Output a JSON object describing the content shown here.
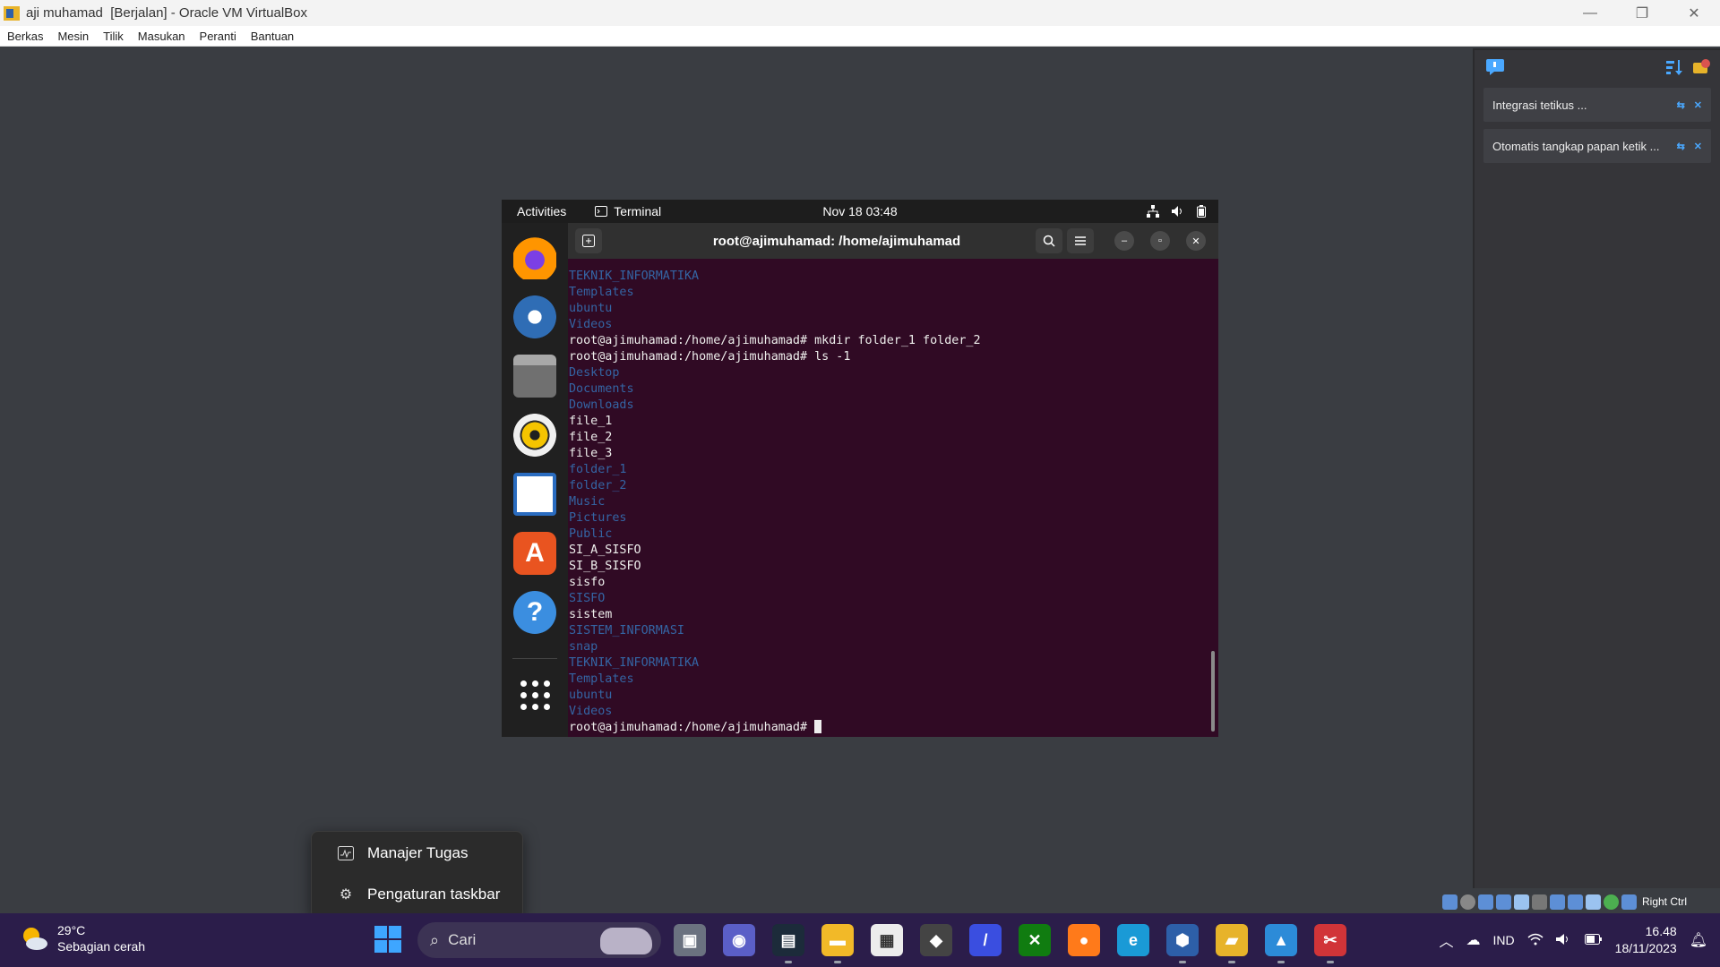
{
  "vbox": {
    "title": "aji muhamad  [Berjalan] - Oracle VM VirtualBox",
    "menu": [
      "Berkas",
      "Mesin",
      "Tilik",
      "Masukan",
      "Peranti",
      "Bantuan"
    ],
    "window_controls": {
      "minimize": "—",
      "restore": "❐",
      "close": "✕"
    }
  },
  "notifications": [
    {
      "text": "Integrasi tetikus ..."
    },
    {
      "text": "Otomatis tangkap papan ketik ..."
    }
  ],
  "host_key_label": "Right Ctrl",
  "gnome": {
    "activities": "Activities",
    "app_name": "Terminal",
    "clock": "Nov 18  03:48"
  },
  "dock": [
    {
      "name": "firefox",
      "color": "#e66000"
    },
    {
      "name": "thunderbird",
      "color": "#2f6db5"
    },
    {
      "name": "files",
      "color": "#8a8a8a"
    },
    {
      "name": "rhythmbox",
      "color": "#f5c400"
    },
    {
      "name": "libreoffice-writer",
      "color": "#2a6cc0"
    },
    {
      "name": "app-center",
      "color": "#e95420"
    },
    {
      "name": "help",
      "color": "#3b8ee0"
    }
  ],
  "terminal": {
    "title": "root@ajimuhamad: /home/ajimuhamad",
    "lines": [
      {
        "text": "TEKNIK_INFORMATIKA",
        "kind": "dir"
      },
      {
        "text": "Templates",
        "kind": "dir"
      },
      {
        "text": "ubuntu",
        "kind": "dir"
      },
      {
        "text": "Videos",
        "kind": "dir"
      },
      {
        "text": "root@ajimuhamad:/home/ajimuhamad# mkdir folder_1 folder_2",
        "kind": "cmd"
      },
      {
        "text": "root@ajimuhamad:/home/ajimuhamad# ls -1",
        "kind": "cmd"
      },
      {
        "text": "Desktop",
        "kind": "dir"
      },
      {
        "text": "Documents",
        "kind": "dir"
      },
      {
        "text": "Downloads",
        "kind": "dir"
      },
      {
        "text": "file_1",
        "kind": "file"
      },
      {
        "text": "file_2",
        "kind": "file"
      },
      {
        "text": "file_3",
        "kind": "file"
      },
      {
        "text": "folder_1",
        "kind": "dir"
      },
      {
        "text": "folder_2",
        "kind": "dir"
      },
      {
        "text": "Music",
        "kind": "dir"
      },
      {
        "text": "Pictures",
        "kind": "dir"
      },
      {
        "text": "Public",
        "kind": "dir"
      },
      {
        "text": "SI_A_SISFO",
        "kind": "file"
      },
      {
        "text": "SI_B_SISFO",
        "kind": "file"
      },
      {
        "text": "sisfo",
        "kind": "file"
      },
      {
        "text": "SISFO",
        "kind": "dir"
      },
      {
        "text": "sistem",
        "kind": "file"
      },
      {
        "text": "SISTEM_INFORMASI",
        "kind": "dir"
      },
      {
        "text": "snap",
        "kind": "dir"
      },
      {
        "text": "TEKNIK_INFORMATIKA",
        "kind": "dir"
      },
      {
        "text": "Templates",
        "kind": "dir"
      },
      {
        "text": "ubuntu",
        "kind": "dir"
      },
      {
        "text": "Videos",
        "kind": "dir"
      }
    ],
    "prompt": "root@ajimuhamad:/home/ajimuhamad# "
  },
  "context_menu": [
    {
      "label": "Manajer Tugas",
      "icon": "task-manager-icon"
    },
    {
      "label": "Pengaturan taskbar",
      "icon": "gear-icon"
    }
  ],
  "taskbar": {
    "weather_temp": "29°C",
    "weather_desc": "Sebagian cerah",
    "search_placeholder": "Cari",
    "apps": [
      {
        "name": "task-view",
        "color": "#6b7280",
        "glyph": "▣"
      },
      {
        "name": "teams",
        "color": "#5b5fc7",
        "glyph": "◉"
      },
      {
        "name": "ide",
        "color": "#1c2b3a",
        "glyph": "▤"
      },
      {
        "name": "file-explorer",
        "color": "#f2b928",
        "glyph": "▬"
      },
      {
        "name": "ms-store",
        "color": "#ececec",
        "glyph": "▦"
      },
      {
        "name": "unity",
        "color": "#444",
        "glyph": "◆"
      },
      {
        "name": "mendeley",
        "color": "#3a4ee0",
        "glyph": "/"
      },
      {
        "name": "xbox",
        "color": "#107c10",
        "glyph": "✕"
      },
      {
        "name": "firefox",
        "color": "#ff7a1a",
        "glyph": "●"
      },
      {
        "name": "edge",
        "color": "#1a9ad6",
        "glyph": "e"
      },
      {
        "name": "virtualbox",
        "color": "#2d5fa8",
        "glyph": "⬢"
      },
      {
        "name": "virtualbox-vm",
        "color": "#e7b32a",
        "glyph": "▰"
      },
      {
        "name": "photos",
        "color": "#2c8bd8",
        "glyph": "▲"
      },
      {
        "name": "snipping-tool",
        "color": "#d13438",
        "glyph": "✂"
      }
    ],
    "language": "IND",
    "time": "16.48",
    "date": "18/11/2023"
  }
}
